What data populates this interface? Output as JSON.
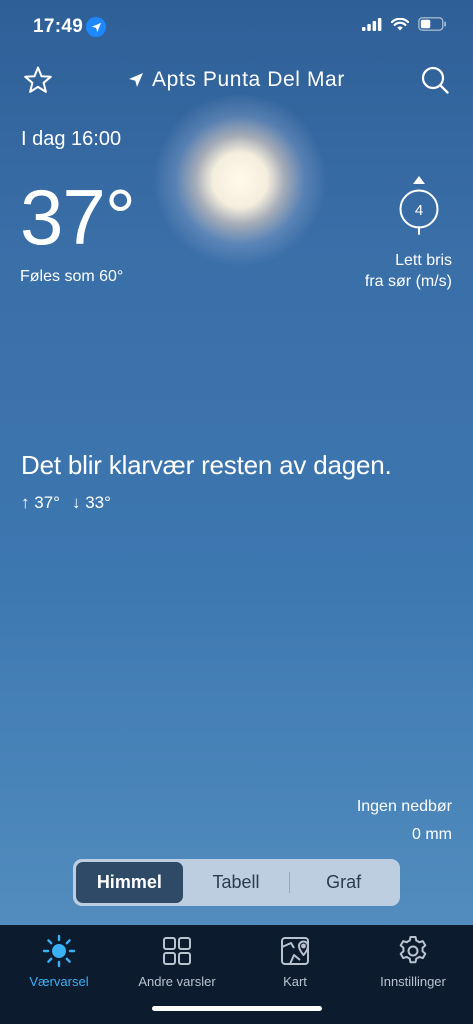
{
  "status_bar": {
    "time": "17:49",
    "icons": [
      "location-arrow-icon",
      "cellular-signal-icon",
      "wifi-icon",
      "battery-icon"
    ]
  },
  "header": {
    "location_name": "Apts Punta Del Mar",
    "icons": [
      "star-icon",
      "location-arrow-icon",
      "search-icon"
    ]
  },
  "current": {
    "time_label": "I dag 16:00",
    "temperature": "37°",
    "feels_like": "Føles som 60°",
    "weather_icon": "sun-icon"
  },
  "wind": {
    "speed": "4",
    "description_line1": "Lett bris",
    "description_line2": "fra sør (m/s)",
    "icon": "wind-direction-icon"
  },
  "forecast": {
    "summary": "Det blir klarvær resten av dagen.",
    "high": "37°",
    "low": "33°",
    "high_arrow": "↑",
    "low_arrow": "↓"
  },
  "precipitation": {
    "label": "Ingen nedbør",
    "amount": "0 mm"
  },
  "view_selector": {
    "options": [
      {
        "label": "Himmel",
        "selected": true
      },
      {
        "label": "Tabell",
        "selected": false
      },
      {
        "label": "Graf",
        "selected": false
      }
    ]
  },
  "tab_bar": {
    "items": [
      {
        "label": "Værvarsel",
        "icon": "sun-icon",
        "active": true
      },
      {
        "label": "Andre varsler",
        "icon": "grid-icon",
        "active": false
      },
      {
        "label": "Kart",
        "icon": "map-icon",
        "active": false
      },
      {
        "label": "Innstillinger",
        "icon": "gear-icon",
        "active": false
      }
    ]
  },
  "colors": {
    "accent": "#3ab1f5",
    "tab_bar_bg": "#0d1b2e",
    "segment_active": "#2e4a66",
    "sky_top": "#2f5f97",
    "sky_bottom": "#5a93c2"
  }
}
